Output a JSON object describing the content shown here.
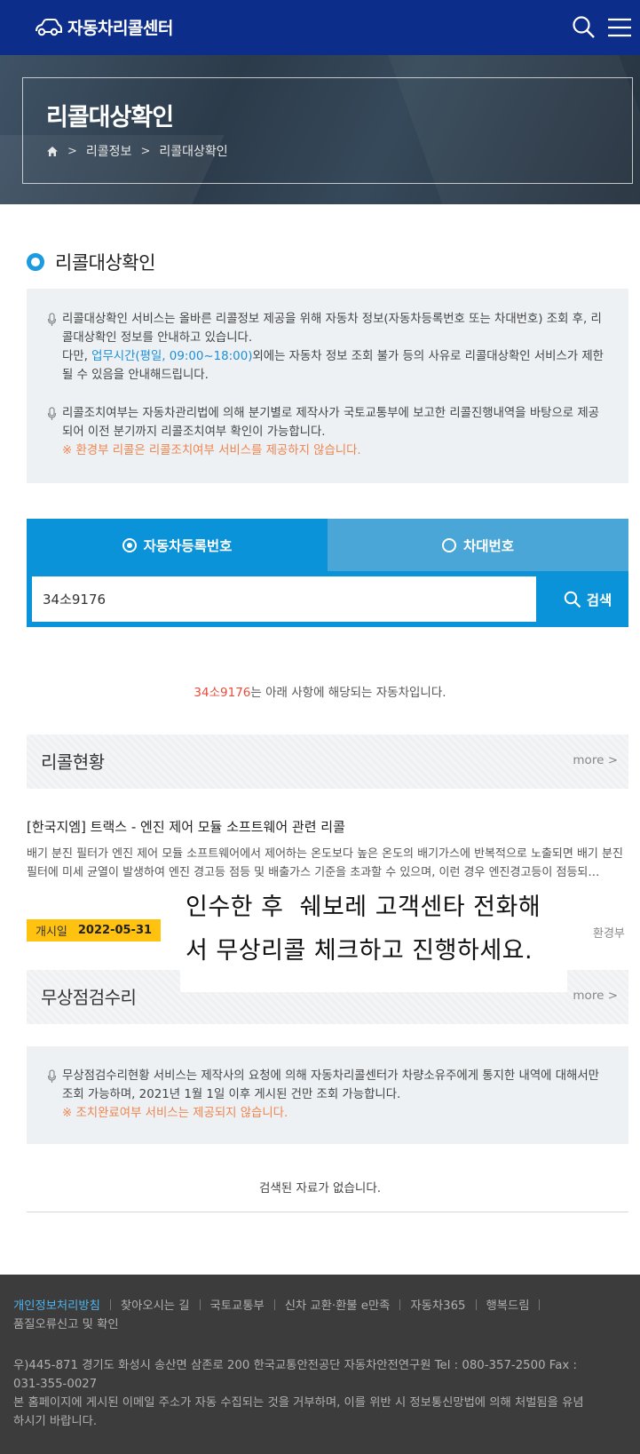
{
  "header": {
    "logo_text": "자동차리콜센터",
    "brand_color": "#0c2d8a"
  },
  "hero": {
    "title": "리콜대상확인",
    "breadcrumb": [
      "리콜정보",
      "리콜대상확인"
    ]
  },
  "section_title": "리콜대상확인",
  "notice1": {
    "p1_line": "리콜대상확인 서비스는 올바른 리콜정보 제공을 위해 자동차 정보(자동차등록번호 또는 차대번호) 조회 후, 리콜대상확인 정보를 안내하고 있습니다.",
    "p1b_before": "다만, ",
    "p1b_link": "업무시간(평일, 09:00~18:00)",
    "p1b_after": "외에는 자동차 정보 조회 불가 등의 사유로 리콜대상확인 서비스가 제한될 수 있음을 안내해드립니다.",
    "p2_line": "리콜조치여부는 자동차관리법에 의해 분기별로 제작사가 국토교통부에 보고한 리콜진행내역을 바탕으로 제공되어 이전 분기까지 리콜조치여부 확인이 가능합니다.",
    "p2_warn": "※ 환경부 리콜은 리콜조치여부 서비스를 제공하지 않습니다."
  },
  "tabs": [
    {
      "label": "자동차등록번호",
      "selected": true
    },
    {
      "label": "차대번호",
      "selected": false
    }
  ],
  "search": {
    "value": "34소9176",
    "button_label": "검색"
  },
  "result": {
    "plate": "34소9176",
    "text": "는 아래 사항에 해당되는 자동차입니다."
  },
  "recall_status": {
    "title": "리콜현황",
    "more": "more",
    "item": {
      "title": "[한국지엠] 트랙스 - 엔진 제어 모듈 소프트웨어 관련 리콜",
      "desc": "배기 분진 필터가 엔진 제어 모듈 소프트웨어에서 제어하는 온도보다 높은 온도의 배기가스에 반복적으로 노출되면 배기 분진 필터에 미세 균열이 발생하여 엔진 경고등 점등 및 배출가스 기준을 초과할 수 있으며, 이런 경우 엔진경고등이 점등되…",
      "date_label": "개시일",
      "date": "2022-05-31",
      "agency": "환경부"
    }
  },
  "overlay_text": {
    "line1": "인수한 후  쉐보레 고객센타 전화해",
    "line2": "서 무상리콜 체크하고 진행하세요."
  },
  "free_repair": {
    "title": "무상점검수리",
    "more": "more",
    "notice_line": "무상점검수리현황 서비스는 제작사의 요청에 의해 자동차리콜센터가 차량소유주에게 통지한 내역에 대해서만 조회 가능하며, 2021년 1월 1일 이후 게시된 건만 조회 가능합니다.",
    "notice_warn": "※ 조치완료여부 서비스는 제공되지 않습니다.",
    "empty": "검색된 자료가 없습니다."
  },
  "footer": {
    "links": [
      "개인정보처리방침",
      "찾아오시는 길",
      "국토교통부",
      "신차 교환·환불 e만족",
      "자동차365",
      "행복드림",
      "품질오류신고 및 확인"
    ],
    "address": "우)445-871 경기도 화성시 송산면 삼존로 200 한국교통안전공단 자동차안전연구원 Tel : 080-357-2500 Fax : 031-355-0027",
    "copyright": "본 홈페이지에 게시된 이메일 주소가 자동 수집되는 것을 거부하며, 이를 위반 시 정보통신망법에 의해 처벌됨을 유념하시기 바랍니다."
  }
}
